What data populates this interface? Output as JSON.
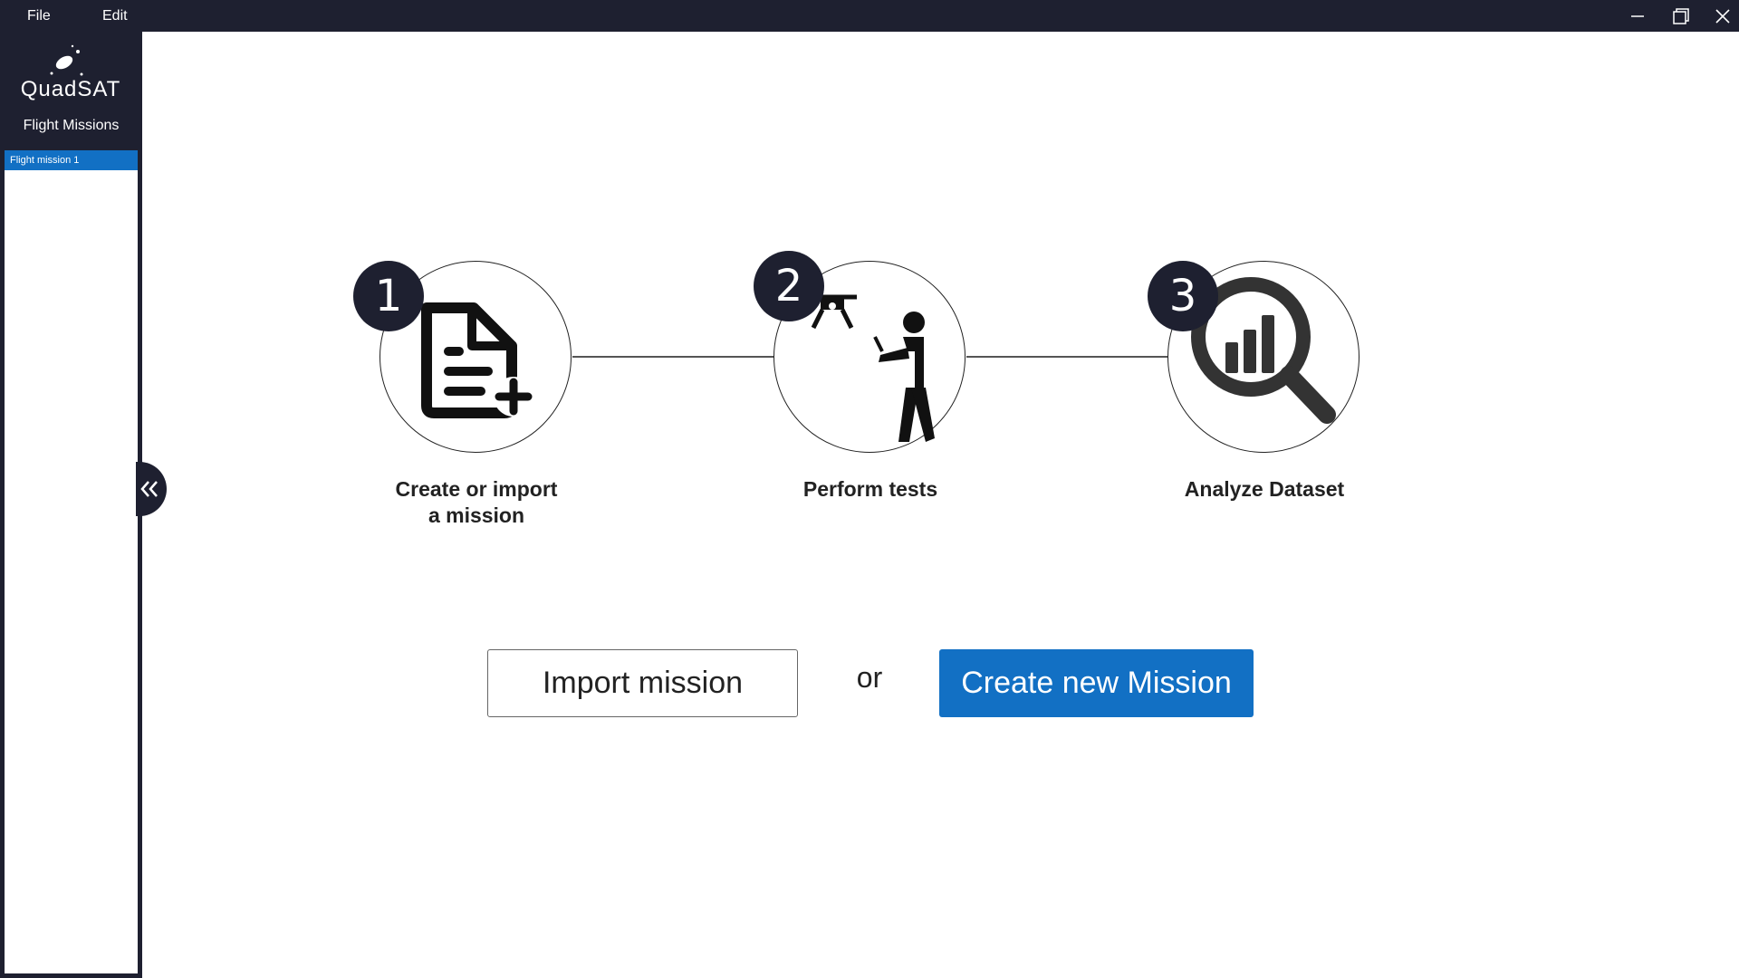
{
  "menu": {
    "file": "File",
    "edit": "Edit"
  },
  "window_controls": [
    "minimize-icon",
    "maximize-icon",
    "close-icon"
  ],
  "sidebar": {
    "logo_text": "QuadSAT",
    "title": "Flight Missions",
    "missions": [
      {
        "label": "Flight mission 1",
        "selected": true
      }
    ],
    "collapse_icon": "double-chevron-left-icon"
  },
  "steps": [
    {
      "number": "1",
      "label_line1": "Create or import",
      "label_line2": "a mission",
      "icon": "file-add-icon"
    },
    {
      "number": "2",
      "label_line1": "Perform tests",
      "label_line2": "",
      "icon": "drone-operator-icon"
    },
    {
      "number": "3",
      "label_line1": "Analyze Dataset",
      "label_line2": "",
      "icon": "magnifier-chart-icon"
    }
  ],
  "actions": {
    "import_label": "Import mission",
    "or_label": "or",
    "create_label": "Create new Mission"
  },
  "colors": {
    "titlebar": "#1e2030",
    "accent": "#1270c4",
    "badge": "#1e2030"
  }
}
